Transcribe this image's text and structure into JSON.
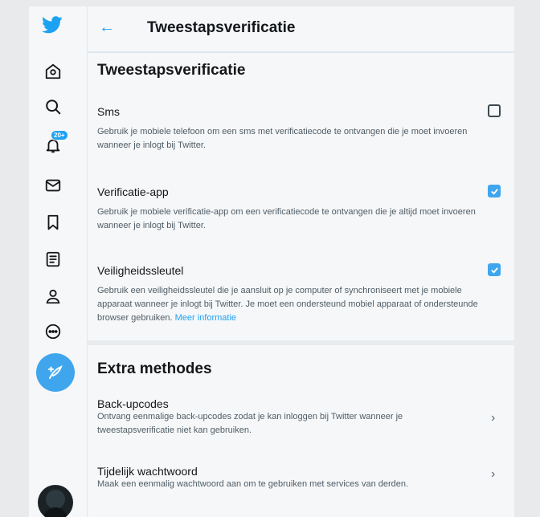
{
  "header": {
    "back_icon": "arrow-left-icon",
    "title": "Tweestapsverificatie"
  },
  "section_two_step": {
    "title": "Tweestapsverificatie",
    "options": [
      {
        "label": "Sms",
        "description": "Gebruik je mobiele telefoon om een sms met verificatiecode te ontvangen die je moet invoeren wanneer je inlogt bij Twitter.",
        "checked": false
      },
      {
        "label": "Verificatie-app",
        "description": "Gebruik je mobiele verificatie-app om een verificatiecode te ontvangen die je altijd moet invoeren wanneer je inlogt bij Twitter.",
        "checked": true
      },
      {
        "label": "Veiligheidssleutel",
        "description": "Gebruik een veiligheidssleutel die je aansluit op je computer of synchroniseert met je mobiele apparaat wanneer je inlogt bij Twitter. Je moet een ondersteund mobiel apparaat of ondersteunde browser gebruiken.",
        "link": "Meer informatie",
        "checked": true
      }
    ]
  },
  "section_extra": {
    "title": "Extra methodes",
    "rows": [
      {
        "label": "Back-upcodes",
        "description": "Ontvang eenmalige back-upcodes zodat je kan inloggen bij Twitter wanneer je tweestapsverificatie niet kan gebruiken."
      },
      {
        "label": "Tijdelijk wachtwoord",
        "description": "Maak een eenmalig wachtwoord aan om te gebruiken met services van derden."
      }
    ]
  },
  "sidebar": {
    "notification_badge": "20+",
    "icons": [
      "twitter-logo-icon",
      "home-icon",
      "search-icon",
      "notifications-icon",
      "messages-icon",
      "bookmarks-icon",
      "lists-icon",
      "profile-icon",
      "more-icon",
      "compose-tweet-icon"
    ]
  },
  "colors": {
    "accent": "#1da1f2",
    "background": "#f6f7f8"
  }
}
